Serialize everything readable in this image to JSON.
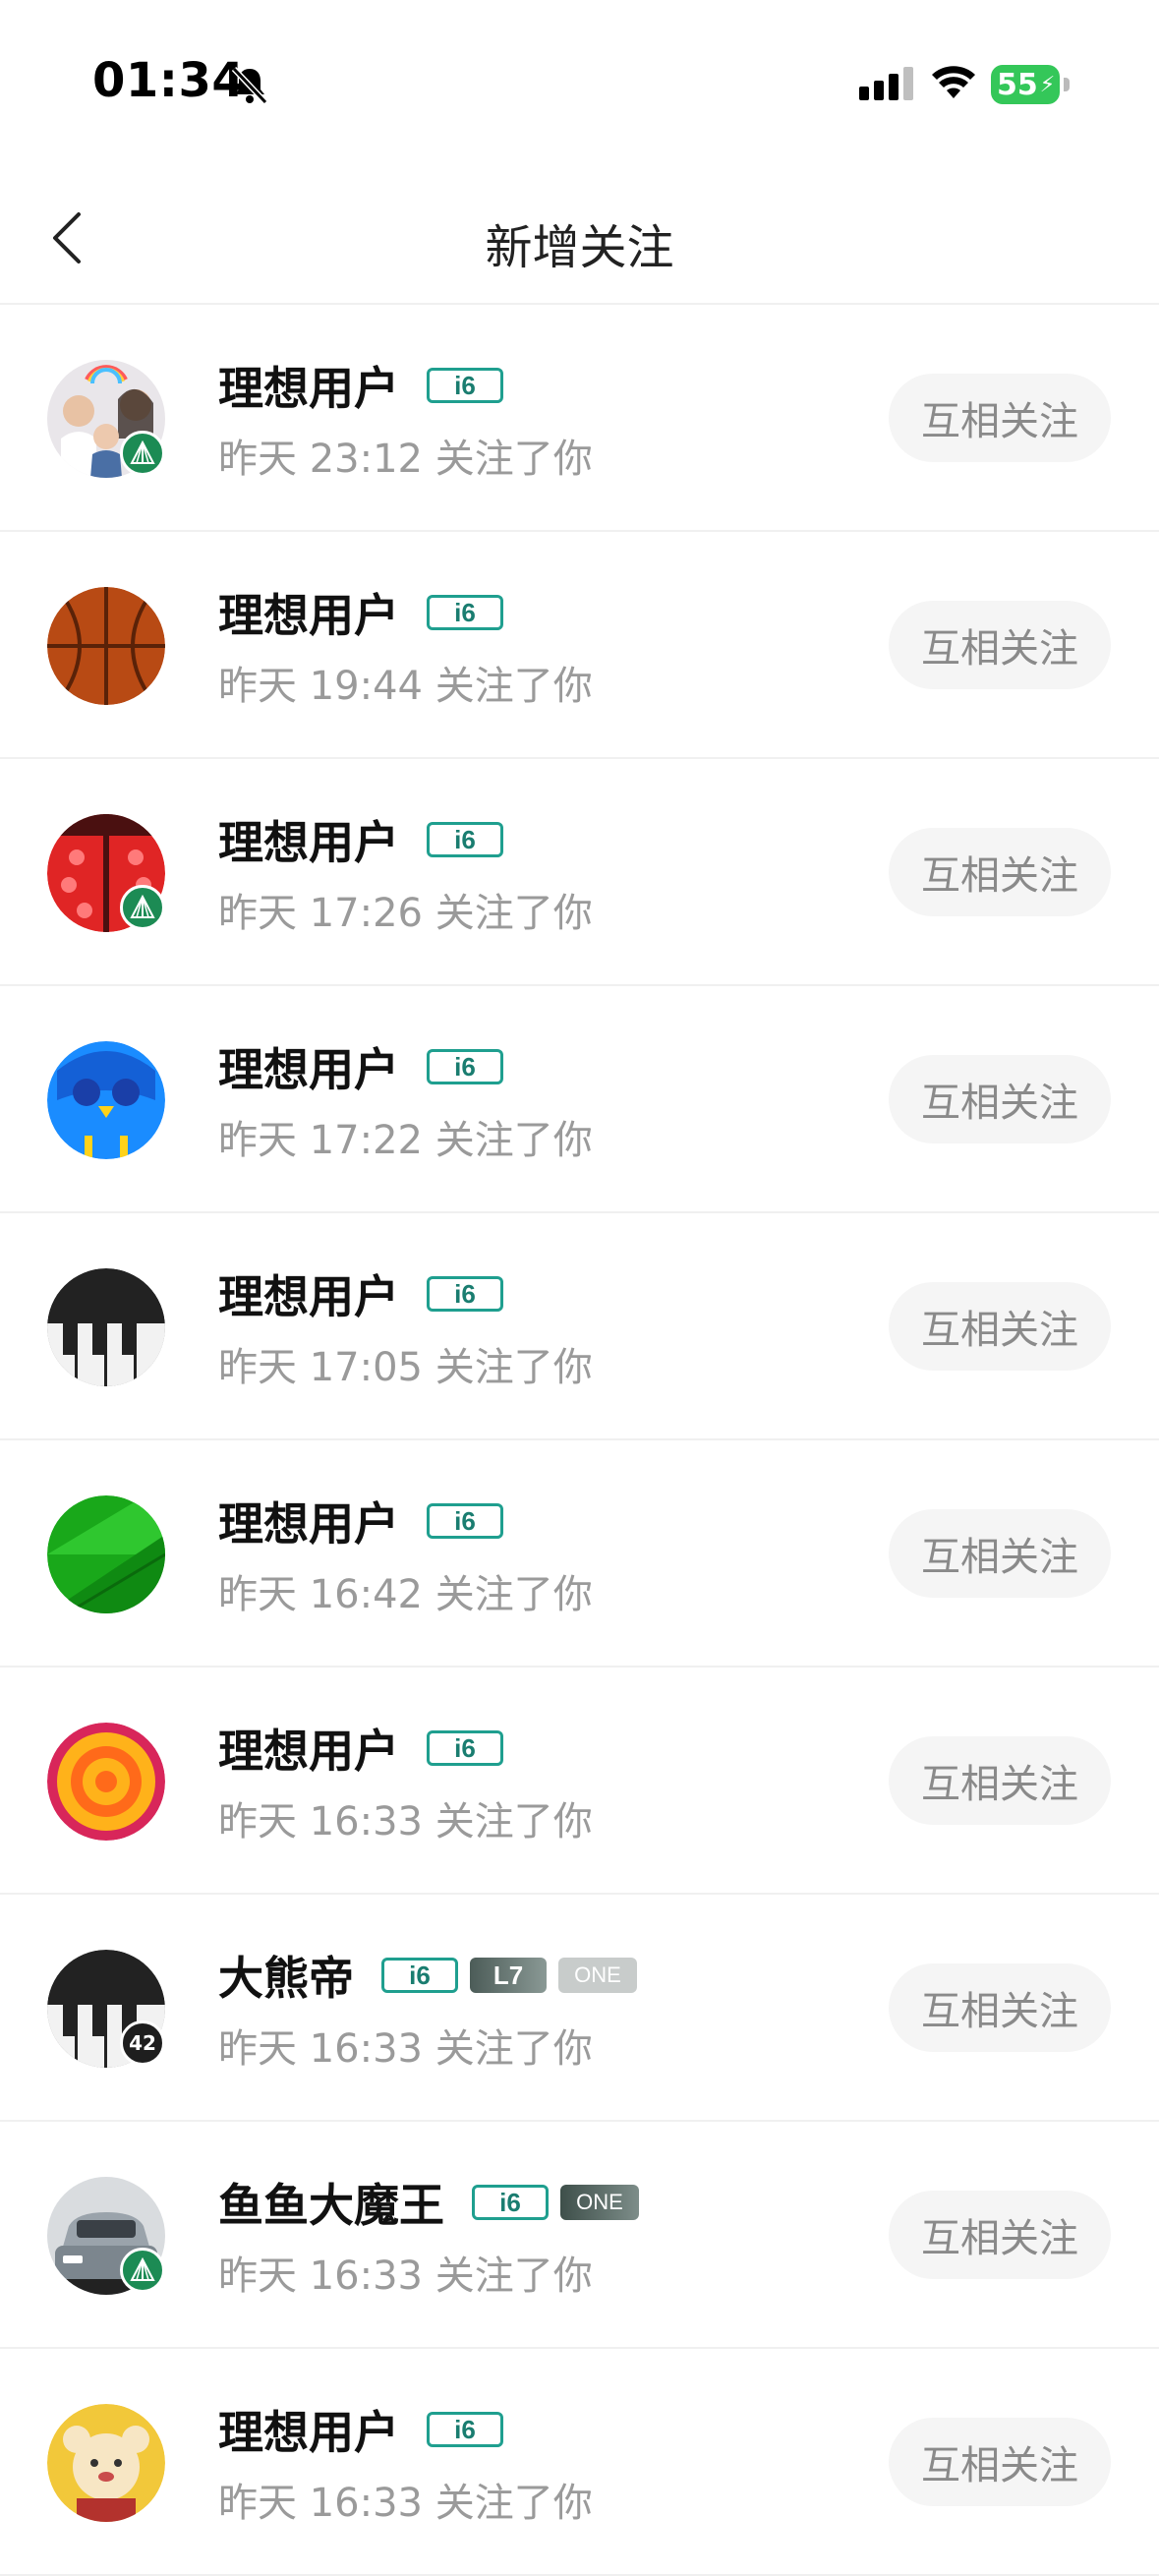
{
  "status_bar": {
    "time": "01:34",
    "battery": "55"
  },
  "header": {
    "title": "新增关注"
  },
  "follow_label": "互相关注",
  "items": [
    {
      "name": "理想用户",
      "tags": [
        "i6"
      ],
      "subtitle": "昨天 23:12 关注了你",
      "avatar": "family-photo",
      "badge": "leaf"
    },
    {
      "name": "理想用户",
      "tags": [
        "i6"
      ],
      "subtitle": "昨天 19:44 关注了你",
      "avatar": "basketball",
      "badge": ""
    },
    {
      "name": "理想用户",
      "tags": [
        "i6"
      ],
      "subtitle": "昨天 17:26 关注了你",
      "avatar": "ladybug",
      "badge": "leaf"
    },
    {
      "name": "理想用户",
      "tags": [
        "i6"
      ],
      "subtitle": "昨天 17:22 关注了你",
      "avatar": "owl",
      "badge": ""
    },
    {
      "name": "理想用户",
      "tags": [
        "i6"
      ],
      "subtitle": "昨天 17:05 关注了你",
      "avatar": "piano",
      "badge": ""
    },
    {
      "name": "理想用户",
      "tags": [
        "i6"
      ],
      "subtitle": "昨天 16:42 关注了你",
      "avatar": "green-leaf",
      "badge": ""
    },
    {
      "name": "理想用户",
      "tags": [
        "i6"
      ],
      "subtitle": "昨天 16:33 关注了你",
      "avatar": "target",
      "badge": ""
    },
    {
      "name": "大熊帝",
      "tags": [
        "i6",
        "L7",
        "ONE"
      ],
      "subtitle": "昨天 16:33 关注了你",
      "avatar": "piano",
      "badge": "42"
    },
    {
      "name": "鱼鱼大魔王",
      "tags": [
        "i6",
        "ONE"
      ],
      "subtitle": "昨天 16:33 关注了你",
      "avatar": "car-photo",
      "badge": "leaf"
    },
    {
      "name": "理想用户",
      "tags": [
        "i6"
      ],
      "subtitle": "昨天 16:33 关注了你",
      "avatar": "toy-photo",
      "badge": ""
    }
  ]
}
